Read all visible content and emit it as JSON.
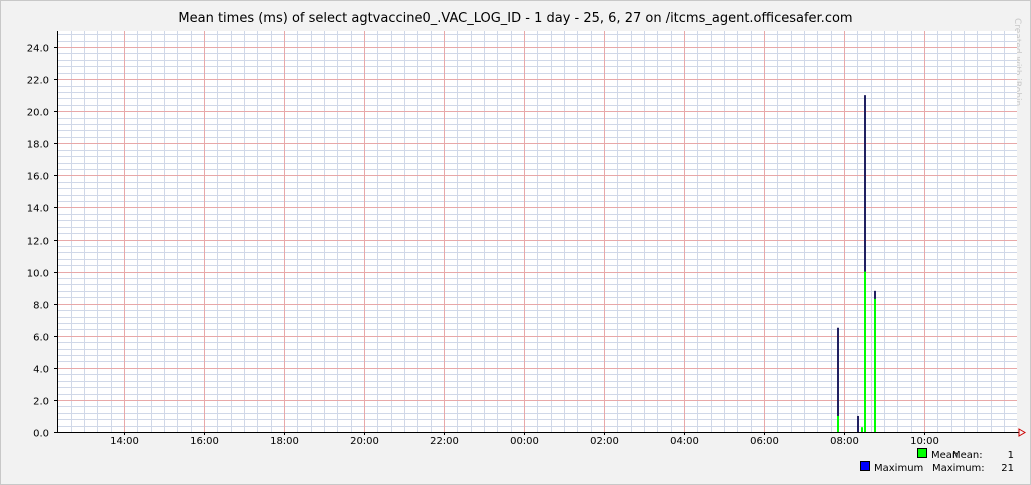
{
  "watermark": "Created with jRobin",
  "chart_data": {
    "type": "bar",
    "title": "Mean times (ms) of select agtvaccine0_.VAC_LOG_ID - 1 day - 25, 6, 27 on /itcms_agent.officesafer.com",
    "xlabel": "",
    "ylabel": "",
    "ylim": [
      0,
      25
    ],
    "y_ticks": [
      "0.0",
      "2.0",
      "4.0",
      "6.0",
      "8.0",
      "10.0",
      "12.0",
      "14.0",
      "16.0",
      "18.0",
      "20.0",
      "22.0",
      "24.0"
    ],
    "x_ticks": [
      "14:00",
      "16:00",
      "18:00",
      "20:00",
      "22:00",
      "00:00",
      "02:00",
      "04:00",
      "06:00",
      "08:00",
      "10:00"
    ],
    "grid": true,
    "legend": "bottom-right",
    "colors": {
      "mean": "#00ff00",
      "maximum": "#0000ff",
      "grid_major": "#e8a8a8",
      "grid_minor": "#d0d8e8",
      "axis": "#000000",
      "arrow": "#cc0000"
    },
    "series": [
      {
        "name": "Mean",
        "color": "#00ff00",
        "points": [
          {
            "t": "07:50",
            "v": 1.0
          },
          {
            "t": "08:25",
            "v": 0.3
          },
          {
            "t": "08:30",
            "v": 10.0
          },
          {
            "t": "08:45",
            "v": 8.3
          }
        ]
      },
      {
        "name": "Maximum",
        "color": "#0000ff",
        "points": [
          {
            "t": "07:50",
            "v": 6.5
          },
          {
            "t": "08:20",
            "v": 1.0
          },
          {
            "t": "08:30",
            "v": 21.0
          },
          {
            "t": "08:45",
            "v": 8.8
          }
        ]
      }
    ],
    "legend_items": [
      {
        "label": "Mean",
        "stat_label": "Mean:",
        "stat_value": "1",
        "color": "#00ff00"
      },
      {
        "label": "Maximum",
        "stat_label": "Maximum:",
        "stat_value": "21",
        "color": "#0000ff"
      }
    ]
  }
}
